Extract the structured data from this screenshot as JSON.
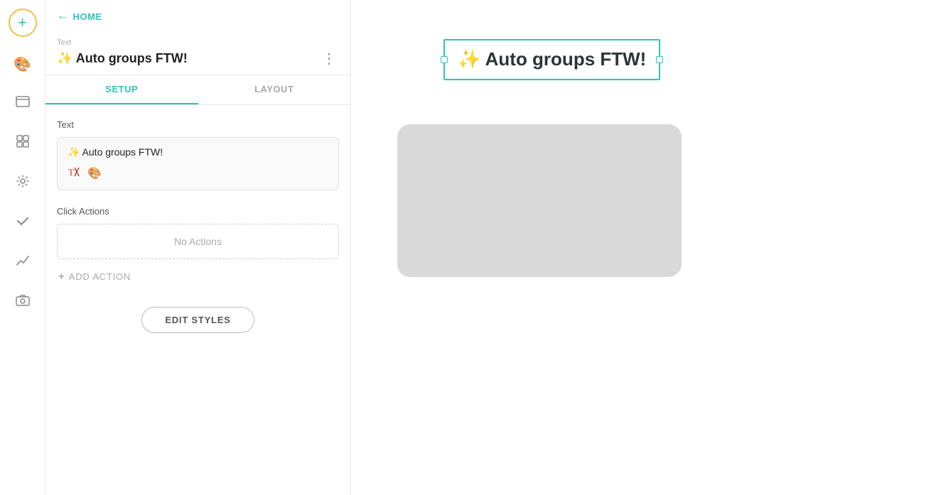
{
  "sidebar": {
    "add_button_label": "+",
    "icons": [
      {
        "name": "palette-icon",
        "symbol": "🎨"
      },
      {
        "name": "layout-icon",
        "symbol": "▭"
      },
      {
        "name": "grid-icon",
        "symbol": "⊞"
      },
      {
        "name": "settings-icon",
        "symbol": "⚙"
      },
      {
        "name": "check-icon",
        "symbol": "✓"
      },
      {
        "name": "chart-icon",
        "symbol": "📈"
      },
      {
        "name": "camera-icon",
        "symbol": "📷"
      }
    ]
  },
  "panel": {
    "back_label": "HOME",
    "type_label": "Text",
    "title": "✨ Auto groups FTW!",
    "more_icon": "⋮",
    "tabs": [
      {
        "id": "setup",
        "label": "SETUP",
        "active": true
      },
      {
        "id": "layout",
        "label": "LAYOUT",
        "active": false
      }
    ],
    "setup": {
      "text_section_label": "Text",
      "text_value": "✨ Auto groups FTW!",
      "text_toolbar": [
        {
          "name": "format-clear-icon",
          "symbol": "T×"
        },
        {
          "name": "color-icon",
          "symbol": "🎨"
        }
      ],
      "click_actions_label": "Click Actions",
      "no_actions_text": "No Actions",
      "add_action_label": "ADD ACTION",
      "edit_styles_label": "EDIT STYLES"
    }
  },
  "canvas": {
    "text_widget_content": "✨ Auto groups FTW!",
    "gray_box_visible": true
  }
}
